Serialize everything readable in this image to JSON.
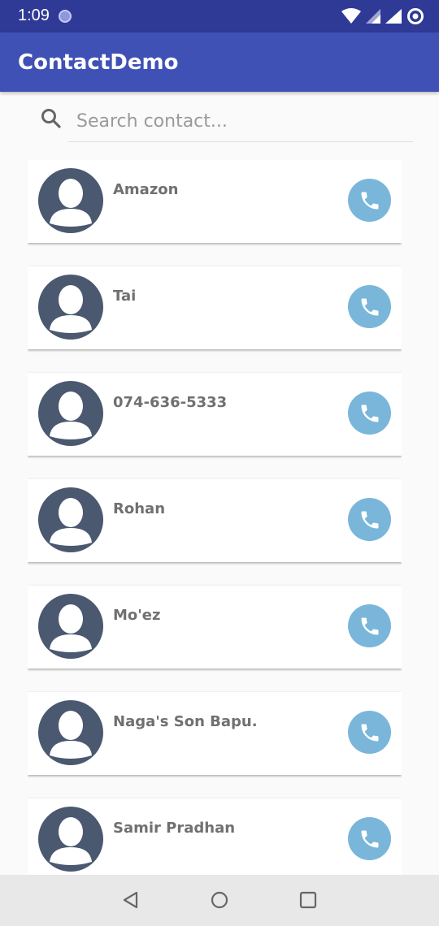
{
  "status_bar": {
    "time": "1:09",
    "icons": [
      "notification-dot-icon",
      "wifi-icon",
      "signal-icon",
      "signal-icon",
      "sync-icon"
    ]
  },
  "app_bar": {
    "title": "ContactDemo",
    "color": "#3f51b5"
  },
  "search": {
    "icon": "search-icon",
    "placeholder": "Search contact...",
    "value": ""
  },
  "contacts": [
    {
      "name": "Amazon"
    },
    {
      "name": "Tai"
    },
    {
      "name": "074-636-5333"
    },
    {
      "name": "Rohan"
    },
    {
      "name": "Mo'ez"
    },
    {
      "name": "Naga's Son Bapu."
    },
    {
      "name": "Samir Pradhan"
    }
  ],
  "colors": {
    "status_bar": "#2f3a97",
    "avatar": "#4a5870",
    "call_button": "#7ab6d9"
  },
  "nav_bar": {
    "buttons": [
      "back-icon",
      "home-icon",
      "recents-icon"
    ]
  }
}
